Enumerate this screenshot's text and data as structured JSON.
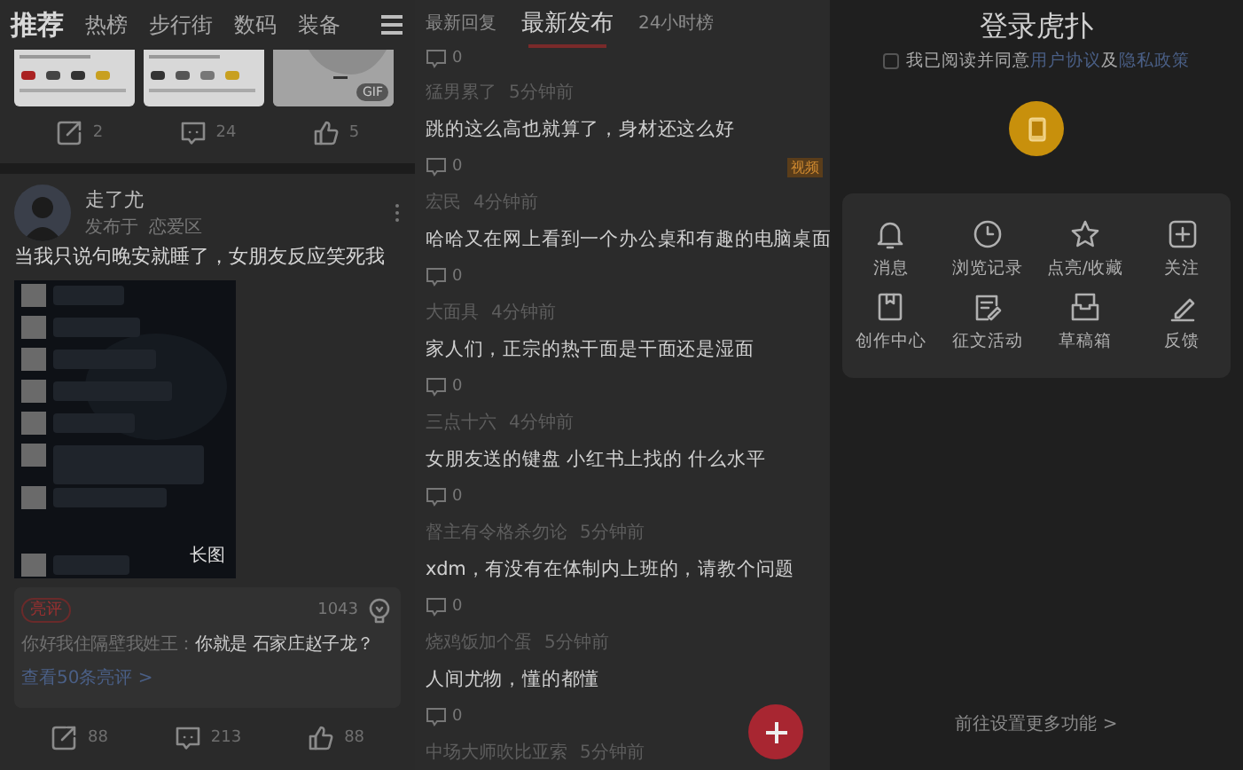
{
  "feed": {
    "tabs": [
      {
        "label": "推荐",
        "selected": true
      },
      {
        "label": "热榜",
        "selected": false
      },
      {
        "label": "步行街",
        "selected": false
      },
      {
        "label": "数码",
        "selected": false
      },
      {
        "label": "装备",
        "selected": false
      }
    ],
    "previous_post": {
      "media": [
        {
          "kind": "picture"
        },
        {
          "kind": "picture"
        },
        {
          "kind": "picture",
          "badge": "GIF"
        }
      ],
      "shares": "2",
      "comments": "24",
      "likes": "5"
    },
    "post": {
      "author": "走了尤",
      "posted_in_label": "发布于",
      "section": "恋爱区",
      "title": "当我只说句晚安就睡了，女朋友反应笑死我",
      "image_badge": "长图",
      "hot_comment": {
        "badge": "亮评",
        "likes": "1043",
        "commenter": "你好我住隔壁我姓王：",
        "text": "你就是 石家庄赵子龙？",
        "more_link": "查看50条亮评 >"
      },
      "shares": "88",
      "comments": "213",
      "likes": "88"
    }
  },
  "latest": {
    "tabs": [
      {
        "label": "最新回复",
        "selected": false
      },
      {
        "label": "最新发布",
        "selected": true
      },
      {
        "label": "24小时榜",
        "selected": false
      }
    ],
    "cut_off_comments": "0",
    "threads": [
      {
        "author": "猛男累了",
        "time": "5分钟前",
        "title": "跳的这么高也就算了，身材还这么好",
        "comments": "0",
        "badge": "视频"
      },
      {
        "author": "宏民",
        "time": "4分钟前",
        "title": "哈哈又在网上看到一个办公桌和有趣的电脑桌面",
        "comments": "0"
      },
      {
        "author": "大面具",
        "time": "4分钟前",
        "title": "家人们，正宗的热干面是干面还是湿面",
        "comments": "0"
      },
      {
        "author": "三点十六",
        "time": "4分钟前",
        "title": "女朋友送的键盘 小红书上找的 什么水平",
        "comments": "0"
      },
      {
        "author": "督主有令格杀勿论",
        "time": "5分钟前",
        "title": "xdm，有没有在体制内上班的，请教个问题",
        "comments": "0"
      },
      {
        "author": "烧鸡饭加个蛋",
        "time": "5分钟前",
        "title": "人间尤物，懂的都懂",
        "comments": "0"
      },
      {
        "author": "中场大师吹比亚索",
        "time": "5分钟前"
      }
    ]
  },
  "login": {
    "title": "登录虎扑",
    "agreement": {
      "checked": false,
      "text_before": "我已阅读并同意",
      "link_1": "用户协议",
      "joiner": "及",
      "link_2": "隐私政策"
    },
    "features": [
      {
        "label": "消息"
      },
      {
        "label": "浏览记录"
      },
      {
        "label": "点亮/收藏"
      },
      {
        "label": "关注"
      },
      {
        "label": "创作中心"
      },
      {
        "label": "征文活动"
      },
      {
        "label": "草稿箱"
      },
      {
        "label": "反馈"
      }
    ],
    "settings_link": "前往设置更多功能 >"
  }
}
